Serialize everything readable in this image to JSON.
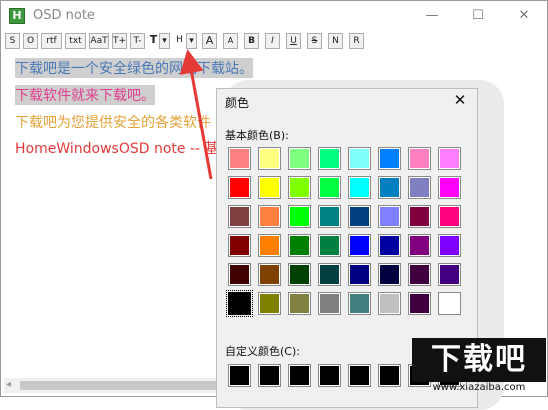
{
  "window": {
    "title": "OSD note",
    "icon": "H"
  },
  "controls": {
    "minimize": "—",
    "maximize": "☐",
    "close": "✕"
  },
  "toolbar": [
    "S",
    "O",
    "rtf",
    "txt",
    "AaT",
    "T+",
    "T-",
    "T",
    "▾",
    "H",
    "▾",
    "A",
    "A",
    "B",
    "I",
    "U",
    "S",
    "N",
    "R"
  ],
  "lines": [
    {
      "text": "下载吧是一个安全绿色的网站下载站。",
      "color": "#4a78b8",
      "bg": "#cfcfcf"
    },
    {
      "text": "下载软件就来下载吧。",
      "color": "#e0408f",
      "bg": "#cfcfcf"
    },
    {
      "text": "下载吧为您提供安全的各类软件",
      "color": "#e3a23a",
      "bg": ""
    },
    {
      "text": "HomeWindowsOSD note -- 基",
      "color": "#e43a3a",
      "bg": ""
    }
  ],
  "dialog": {
    "title": "颜色",
    "close": "✕",
    "basic_label": "基本颜色(B):",
    "custom_label": "自定义颜色(C):",
    "basic_colors": [
      [
        "#ff8080",
        "#ffff80",
        "#80ff80",
        "#00ff80",
        "#80ffff",
        "#0080ff",
        "#ff80c0",
        "#ff80ff"
      ],
      [
        "#ff0000",
        "#ffff00",
        "#80ff00",
        "#00ff40",
        "#00ffff",
        "#0080c0",
        "#8080c0",
        "#ff00ff"
      ],
      [
        "#804040",
        "#ff8040",
        "#00ff00",
        "#008080",
        "#004080",
        "#8080ff",
        "#800040",
        "#ff0080"
      ],
      [
        "#800000",
        "#ff8000",
        "#008000",
        "#008040",
        "#0000ff",
        "#0000a0",
        "#800080",
        "#8000ff"
      ],
      [
        "#400000",
        "#804000",
        "#004000",
        "#004040",
        "#000080",
        "#000040",
        "#400040",
        "#400080"
      ],
      [
        "#000000",
        "#808000",
        "#808040",
        "#808080",
        "#408080",
        "#c0c0c0",
        "#400040",
        "#ffffff"
      ]
    ],
    "custom_colors": [
      "#000000",
      "#000000",
      "#000000",
      "#000000",
      "#000000",
      "#000000",
      "#000000",
      "#000000"
    ]
  },
  "watermark": {
    "logo": "下载吧",
    "url": "www.xiazaiba.com"
  }
}
